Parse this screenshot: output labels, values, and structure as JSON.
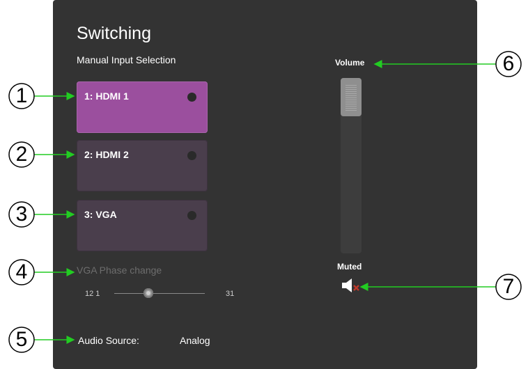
{
  "panel": {
    "title": "Switching",
    "manual_input_label": "Manual Input Selection",
    "inputs": [
      {
        "label": "1: HDMI 1",
        "active": true
      },
      {
        "label": "2: HDMI 2",
        "active": false
      },
      {
        "label": "3: VGA",
        "active": false
      }
    ],
    "vga_phase": {
      "label": "VGA Phase change",
      "min_text": "12 1",
      "max_text": "31",
      "value_fraction": 0.38
    },
    "audio_source": {
      "label": "Audio Source:",
      "value": "Analog"
    },
    "volume": {
      "label": "Volume",
      "level_fraction": 1.0
    },
    "mute": {
      "label": "Muted",
      "icon": "speaker-muted-icon"
    }
  },
  "callouts": [
    "1",
    "2",
    "3",
    "4",
    "5",
    "6",
    "7"
  ],
  "colors": {
    "panel_bg": "#333333",
    "active_input": "#9b4f9e",
    "inactive_input": "#4a3e4c",
    "callout_arrow": "#22cc22"
  }
}
